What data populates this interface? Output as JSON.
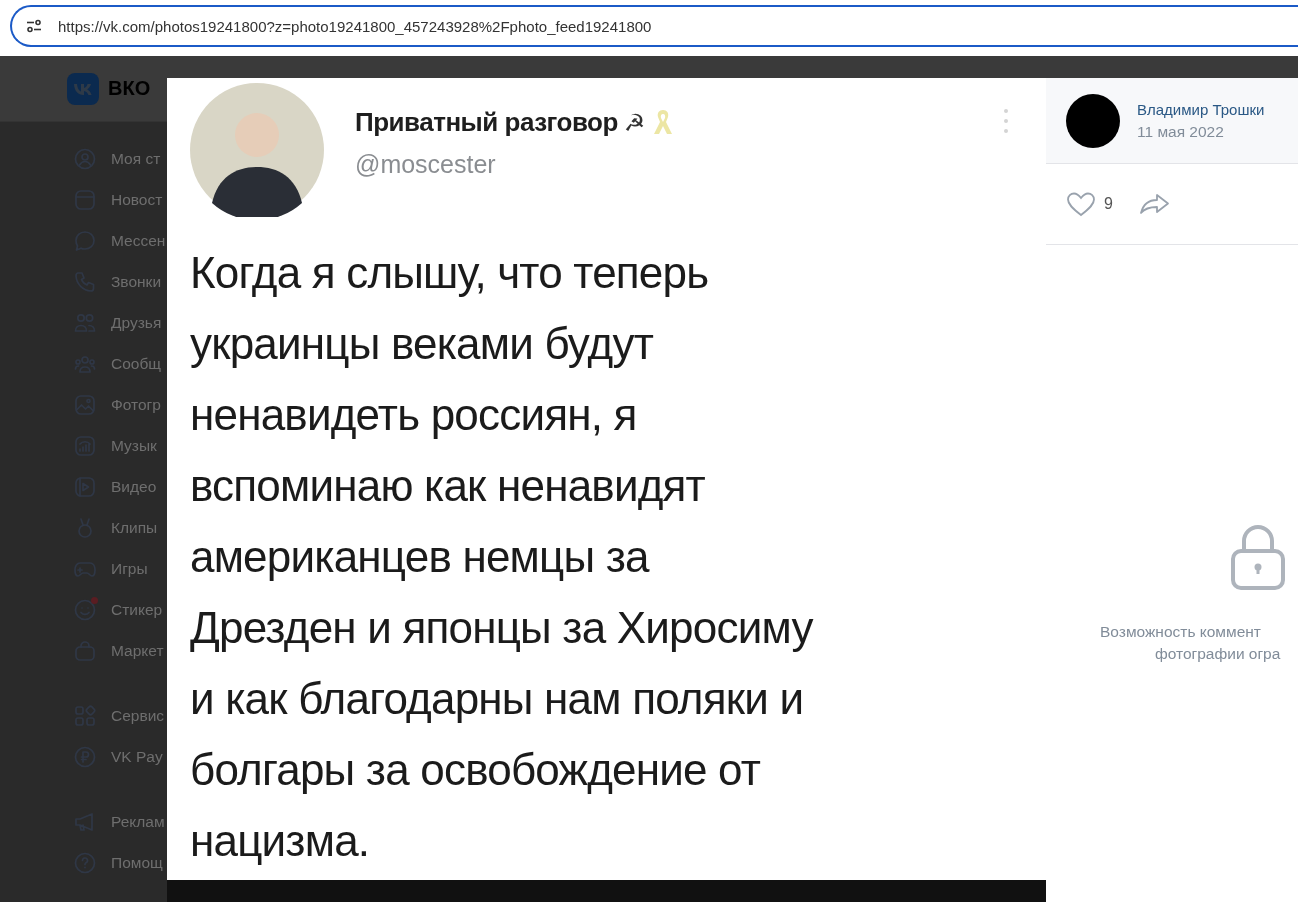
{
  "address_bar": {
    "url": "https://vk.com/photos19241800?z=photo19241800_457243928%2Fphoto_feed19241800"
  },
  "logo": {
    "text": "ВКО"
  },
  "sidebar": {
    "groups": [
      [
        {
          "label": "Моя ст",
          "badge": false
        },
        {
          "label": "Новост",
          "badge": false
        },
        {
          "label": "Мессен",
          "badge": false
        },
        {
          "label": "Звонки",
          "badge": false
        },
        {
          "label": "Друзья",
          "badge": false
        },
        {
          "label": "Сообщ",
          "badge": false
        },
        {
          "label": "Фотогр",
          "badge": false
        },
        {
          "label": "Музык",
          "badge": false
        },
        {
          "label": "Видео",
          "badge": false
        },
        {
          "label": "Клипы",
          "badge": false
        },
        {
          "label": "Игры",
          "badge": false
        },
        {
          "label": "Стикер",
          "badge": true
        },
        {
          "label": "Маркет",
          "badge": false
        }
      ],
      [
        {
          "label": "Сервис",
          "badge": false
        },
        {
          "label": "VK Pay",
          "badge": false
        }
      ],
      [
        {
          "label": "Реклам",
          "badge": false
        },
        {
          "label": "Помощ",
          "badge": false
        }
      ]
    ]
  },
  "photo": {
    "tweet": {
      "name": "Приватный разговор",
      "name_mark": "☭",
      "handle": "@moscester",
      "lines": [
        "Когда я слышу, что теперь",
        "украинцы веками будут",
        "ненавидеть россиян, я",
        "вспоминаю как ненавидят",
        "американцев немцы за",
        "Дрезден и японцы за Хиросиму",
        "и как благодарны нам поляки и",
        "болгары за освобождение от",
        "нацизма."
      ]
    }
  },
  "side_panel": {
    "author": "Владимир Трошки",
    "date": "11 мая 2022",
    "likes": "9",
    "comments_notice": [
      "Возможность коммент",
      "фотографии огра"
    ]
  }
}
